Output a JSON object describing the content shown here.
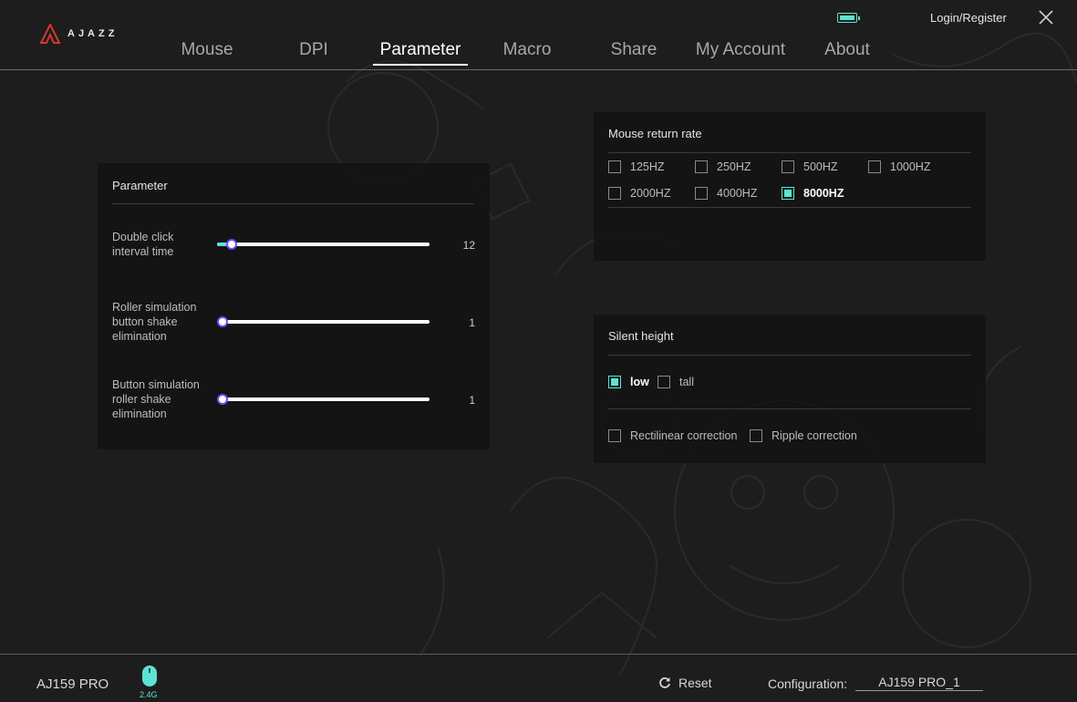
{
  "brand": {
    "name": "AJAZZ",
    "accent_color": "#5ee3d2",
    "logo_color": "#d23a2c"
  },
  "header": {
    "nav": [
      {
        "label": "Mouse",
        "active": false
      },
      {
        "label": "DPI",
        "active": false
      },
      {
        "label": "Parameter",
        "active": true
      },
      {
        "label": "Macro",
        "active": false
      },
      {
        "label": "Share",
        "active": false
      },
      {
        "label": "My Account",
        "active": false
      },
      {
        "label": "About",
        "active": false
      }
    ],
    "login_label": "Login/Register",
    "battery_icon": "battery-full-icon",
    "close_icon": "close-icon"
  },
  "parameter": {
    "title": "Parameter",
    "sliders": [
      {
        "label": "Double click interval time",
        "value": "12",
        "fraction": 0.07
      },
      {
        "label": "Roller simulation button shake elimination",
        "value": "1",
        "fraction": 0.0
      },
      {
        "label": "Button simulation roller shake elimination",
        "value": "1",
        "fraction": 0.0
      }
    ]
  },
  "return_rate": {
    "title": "Mouse return rate",
    "options": [
      {
        "label": "125HZ",
        "checked": false
      },
      {
        "label": "250HZ",
        "checked": false
      },
      {
        "label": "500HZ",
        "checked": false
      },
      {
        "label": "1000HZ",
        "checked": false
      },
      {
        "label": "2000HZ",
        "checked": false
      },
      {
        "label": "4000HZ",
        "checked": false
      },
      {
        "label": "8000HZ",
        "checked": true
      }
    ]
  },
  "silent": {
    "title": "Silent height",
    "options": [
      {
        "label": "low",
        "checked": true
      },
      {
        "label": "tall",
        "checked": false
      }
    ],
    "corrections": [
      {
        "label": "Rectilinear correction",
        "checked": false
      },
      {
        "label": "Ripple correction",
        "checked": false
      }
    ]
  },
  "footer": {
    "device_name": "AJ159 PRO",
    "connection": "2.4G",
    "reset_label": "Reset",
    "config_label": "Configuration:",
    "config_value": "AJ159 PRO_1"
  }
}
